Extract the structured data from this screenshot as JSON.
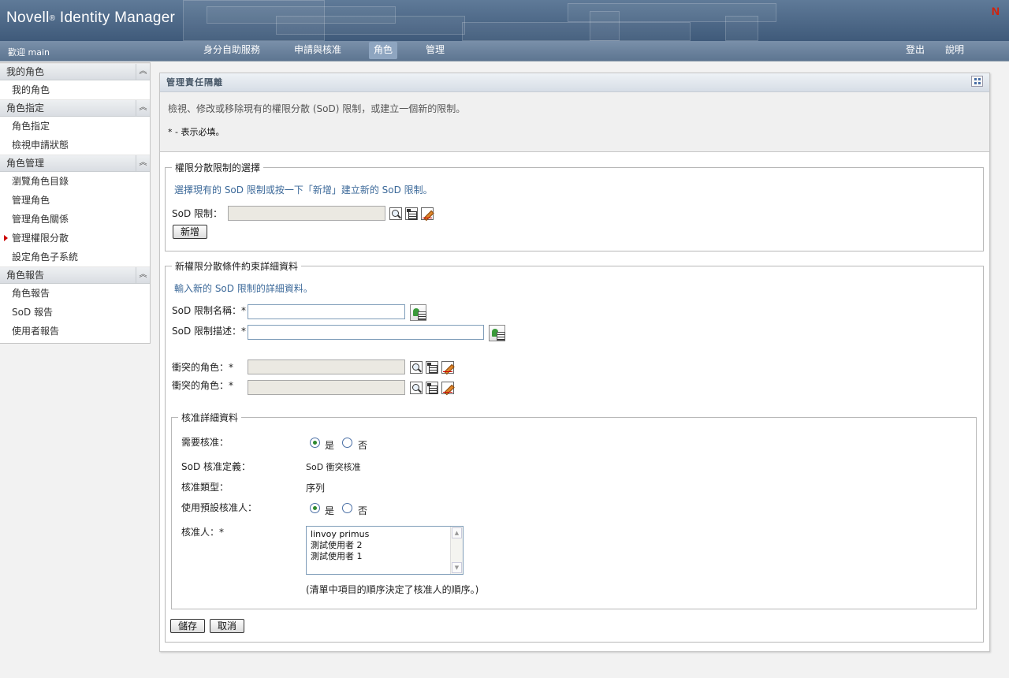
{
  "header": {
    "brand": "Novell",
    "brand_reg": "®",
    "brand_product": " Identity Manager",
    "logo": "N"
  },
  "navbar": {
    "welcome": "歡迎 main",
    "tabs": [
      "身分自助服務",
      "申請與核准",
      "角色",
      "管理"
    ],
    "active_tab": "角色",
    "logout": "登出",
    "help": "說明"
  },
  "sidebar": {
    "sections": [
      {
        "title": "我的角色",
        "items": [
          "我的角色"
        ]
      },
      {
        "title": "角色指定",
        "items": [
          "角色指定",
          "檢視申請狀態"
        ]
      },
      {
        "title": "角色管理",
        "items": [
          "瀏覽角色目錄",
          "管理角色",
          "管理角色關係",
          "管理權限分散",
          "設定角色子系統"
        ]
      },
      {
        "title": "角色報告",
        "items": [
          "角色報告",
          "SoD 報告",
          "使用者報告"
        ]
      }
    ],
    "current_item": "管理權限分散",
    "collapse_icon": "double-chevron-up-icon"
  },
  "panel": {
    "title": "管理責任隔離",
    "description": "檢視、修改或移除現有的權限分散 (SoD) 限制，或建立一個新的限制。",
    "required_note": "* - 表示必填。",
    "selection": {
      "legend": "權限分散限制的選擇",
      "hint": "選擇現有的 SoD 限制或按一下「新增」建立新的 SoD 限制。",
      "sod_label": "SoD 限制：",
      "sod_value": "",
      "new_button": "新增"
    },
    "details": {
      "legend": "新權限分散條件約束詳細資料",
      "hint": "輸入新的 SoD 限制的詳細資料。",
      "name_label": "SoD 限制名稱：*",
      "name_value": "",
      "desc_label": "SoD 限制描述：*",
      "desc_value": "",
      "conflict1_label": "衝突的角色：*",
      "conflict1_value": "",
      "conflict2_label": "衝突的角色：*",
      "conflict2_value": ""
    },
    "approval": {
      "legend": "核准詳細資料",
      "require_label": "需要核准：",
      "require_yes": "是",
      "require_no": "否",
      "require_value": "是",
      "definition_label": "SoD 核准定義：",
      "definition_value": "SoD 衝突核准",
      "type_label": "核准類型：",
      "type_value": "序列",
      "default_label": "使用預設核准人：",
      "default_yes": "是",
      "default_no": "否",
      "default_value": "是",
      "approvers_label": "核准人：*",
      "approvers": [
        "linvoy primus",
        "測試使用者 2",
        "測試使用者 1"
      ],
      "order_note": "(清單中項目的順序決定了核准人的順序。)"
    },
    "save_button": "儲存",
    "cancel_button": "取消"
  }
}
